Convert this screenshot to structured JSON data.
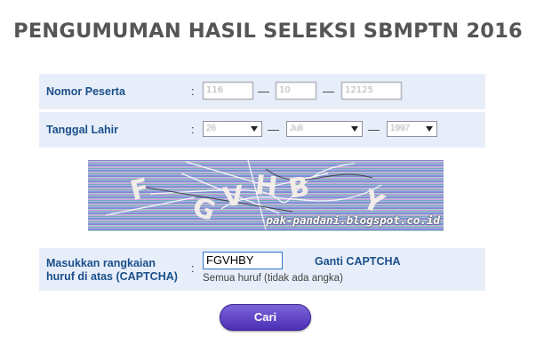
{
  "page": {
    "title": "PENGUMUMAN HASIL SELEKSI SBMPTN 2016"
  },
  "nomor": {
    "label": "Nomor Peserta",
    "colon": ":",
    "part1": "116",
    "part2": "10",
    "part3": "12125",
    "dash": "—"
  },
  "tanggal": {
    "label": "Tanggal Lahir",
    "colon": ":",
    "day": "26",
    "month": "Juli",
    "year": "1997",
    "dash": "—"
  },
  "captcha_image": {
    "chars": [
      "F",
      "G",
      "V",
      "H",
      "B",
      "Y"
    ],
    "watermark": "pak-pandani.blogspot.co.id"
  },
  "captcha": {
    "label_line1": "Masukkan rangkaian",
    "label_line2": "huruf di atas (CAPTCHA)",
    "colon": ":",
    "value": "FGVHBY",
    "ganti": "Ganti CAPTCHA",
    "hint": "Semua huruf (tidak ada angka)"
  },
  "submit": {
    "label": "Cari"
  },
  "colors": {
    "label_blue": "#1a4f8b",
    "row_bg": "#e8eef9",
    "button": "#5a3fc4"
  }
}
